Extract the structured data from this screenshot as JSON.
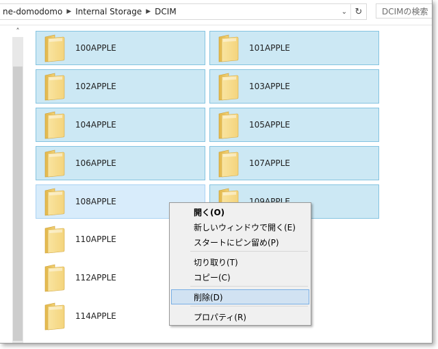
{
  "breadcrumb": {
    "items": [
      "ne-domodomo",
      "Internal Storage",
      "DCIM"
    ]
  },
  "search": {
    "placeholder": "DCIMの検索"
  },
  "icons": {
    "dropdown": "chevron-down-icon",
    "refresh": "refresh-icon",
    "scroll_up": "scroll-up-arrow-icon",
    "folder": "folder-icon",
    "separator": "chevron-right-icon"
  },
  "folders": [
    {
      "name": "100APPLE",
      "state": "selected"
    },
    {
      "name": "101APPLE",
      "state": "selected"
    },
    {
      "name": "102APPLE",
      "state": "selected"
    },
    {
      "name": "103APPLE",
      "state": "selected"
    },
    {
      "name": "104APPLE",
      "state": "selected"
    },
    {
      "name": "105APPLE",
      "state": "selected"
    },
    {
      "name": "106APPLE",
      "state": "selected"
    },
    {
      "name": "107APPLE",
      "state": "selected"
    },
    {
      "name": "108APPLE",
      "state": "hover"
    },
    {
      "name": "109APPLE",
      "state": "selected"
    },
    {
      "name": "110APPLE",
      "state": "normal"
    },
    {
      "name": "112APPLE",
      "state": "normal"
    },
    {
      "name": "114APPLE",
      "state": "normal"
    }
  ],
  "context_menu": {
    "items": [
      {
        "label": "開く(O)",
        "bold": true
      },
      {
        "label": "新しいウィンドウで開く(E)"
      },
      {
        "label": "スタートにピン留め(P)"
      },
      {
        "label": "切り取り(T)"
      },
      {
        "label": "コピー(C)"
      },
      {
        "label": "削除(D)",
        "highlight": true
      },
      {
        "label": "プロパティ(R)"
      }
    ]
  },
  "colors": {
    "selected_bg": "#cce8f4",
    "selected_border": "#84c3e0",
    "hover_bg": "#d8ecfb",
    "menu_highlight": "#d1e2f2"
  }
}
